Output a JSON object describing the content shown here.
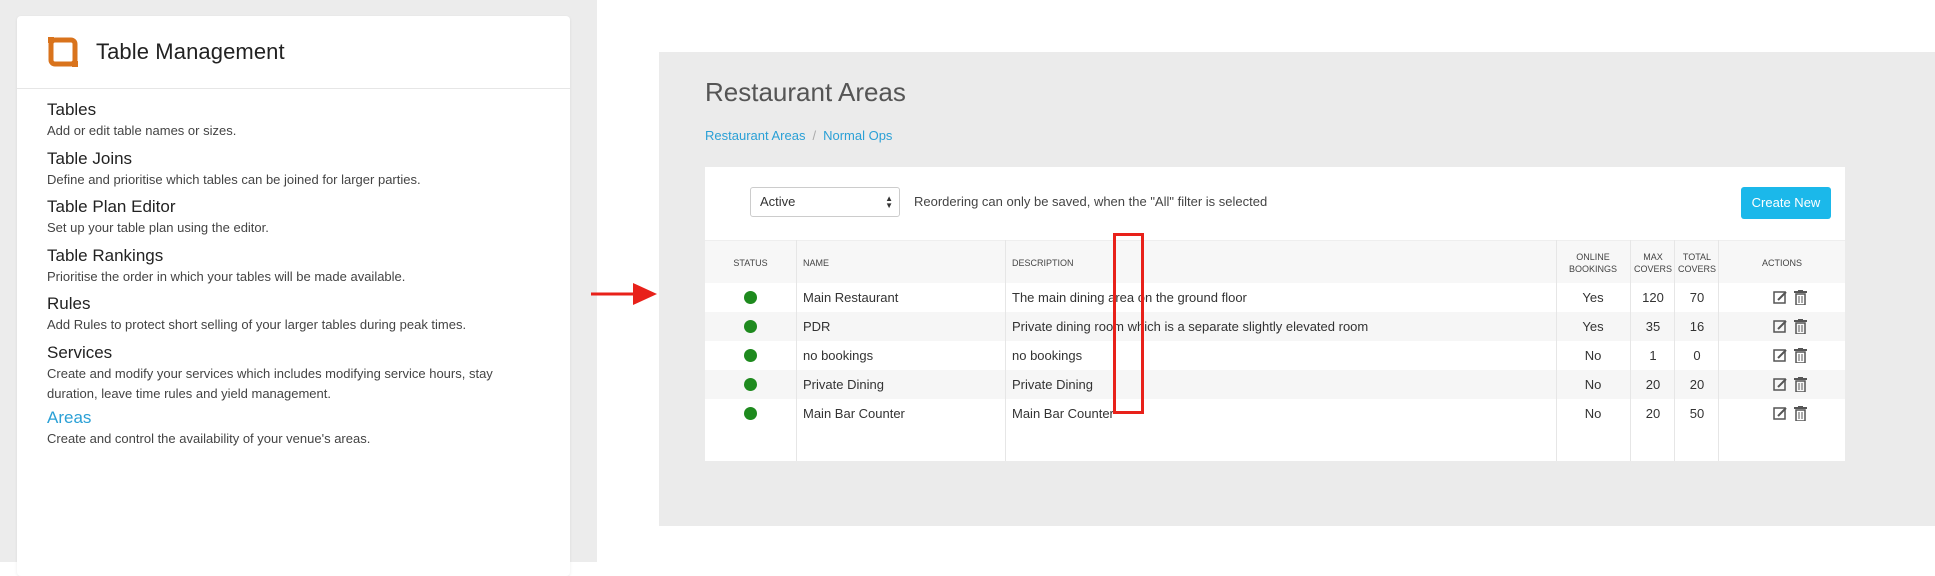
{
  "sidebar": {
    "title": "Table Management",
    "items": [
      {
        "label": "Tables",
        "description": "Add or edit table names or sizes.",
        "active": false
      },
      {
        "label": "Table Joins",
        "description": "Define and prioritise which tables can be joined for larger parties.",
        "active": false
      },
      {
        "label": "Table Plan Editor",
        "description": "Set up your table plan using the editor.",
        "active": false
      },
      {
        "label": "Table Rankings",
        "description": "Prioritise the order in which your tables will be made available.",
        "active": false
      },
      {
        "label": "Rules",
        "description": "Add Rules to protect short selling of your larger tables during peak times.",
        "active": false
      },
      {
        "label": "Services",
        "description": "Create and modify your services which includes modifying service hours, stay duration, leave time rules and yield management.",
        "active": false
      },
      {
        "label": "Areas",
        "description": "Create and control the availability of your venue's areas.",
        "active": true
      }
    ]
  },
  "main": {
    "title": "Restaurant Areas",
    "breadcrumb": [
      "Restaurant Areas",
      "Normal Ops"
    ],
    "filter": {
      "value": "Active",
      "note": "Reordering can only be saved, when the \"All\" filter is selected"
    },
    "create_label": "Create New",
    "columns": {
      "status": "STATUS",
      "name": "NAME",
      "description": "DESCRIPTION",
      "online_1": "ONLINE",
      "online_2": "BOOKINGS",
      "max_1": "MAX",
      "max_2": "COVERS",
      "total_1": "TOTAL",
      "total_2": "COVERS",
      "actions": "ACTIONS"
    },
    "rows": [
      {
        "name": "Main Restaurant",
        "description": "The main dining area on the ground floor",
        "online": "Yes",
        "max": "120",
        "total": "70"
      },
      {
        "name": "PDR",
        "description": "Private dining room which is a separate slightly elevated room",
        "online": "Yes",
        "max": "35",
        "total": "16"
      },
      {
        "name": "no bookings",
        "description": "no bookings",
        "online": "No",
        "max": "1",
        "total": "0"
      },
      {
        "name": "Private Dining",
        "description": "Private Dining",
        "online": "No",
        "max": "20",
        "total": "20"
      },
      {
        "name": "Main Bar Counter",
        "description": "Main Bar Counter",
        "online": "No",
        "max": "20",
        "total": "50"
      }
    ]
  },
  "colors": {
    "accent": "#2aa0d6",
    "button": "#1bb8ea",
    "status_active": "#1e8a1e",
    "highlight": "#e8211a"
  }
}
